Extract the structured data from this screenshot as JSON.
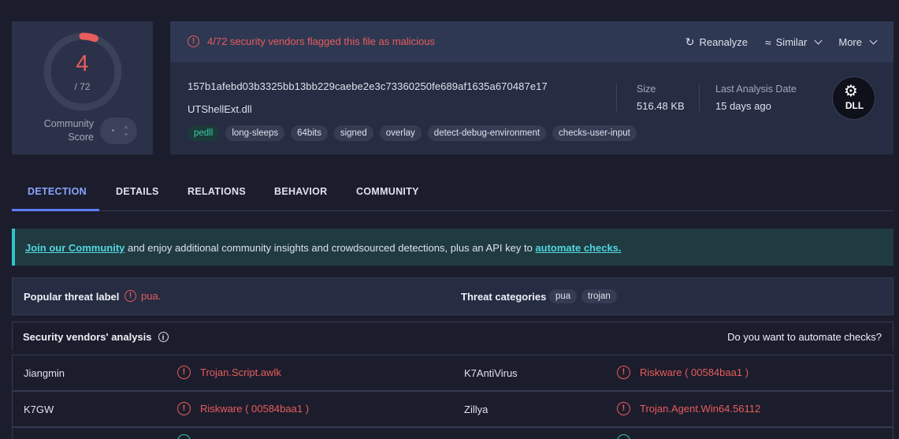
{
  "score": {
    "detections": "4",
    "total": "/ 72",
    "detection_ratio": 0.0556,
    "community_label_line1": "Community",
    "community_label_line2": "Score"
  },
  "header": {
    "flag_text": "4/72 security vendors flagged this file as malicious",
    "actions": {
      "reanalyze": "Reanalyze",
      "similar": "Similar",
      "more": "More"
    }
  },
  "file": {
    "hash": "157b1afebd03b3325bb13bb229caebe2e3c73360250fe689af1635a670487e17",
    "name": "UTShellExt.dll",
    "tags": [
      "pedll",
      "long-sleeps",
      "64bits",
      "signed",
      "overlay",
      "detect-debug-environment",
      "checks-user-input"
    ],
    "size_label": "Size",
    "size_value": "516.48 KB",
    "last_analysis_label": "Last Analysis Date",
    "last_analysis_value": "15 days ago",
    "type_badge": "DLL"
  },
  "tabs": [
    "DETECTION",
    "DETAILS",
    "RELATIONS",
    "BEHAVIOR",
    "COMMUNITY"
  ],
  "banner": {
    "link1": "Join our Community",
    "middle": " and enjoy additional community insights and crowdsourced detections, plus an API key to ",
    "link2": "automate checks."
  },
  "threat": {
    "popular_label": "Popular threat label",
    "popular_value": "pua.",
    "categories_label": "Threat categories",
    "categories": [
      "pua",
      "trojan"
    ]
  },
  "vendors": {
    "title": "Security vendors' analysis",
    "automate": "Do you want to automate checks?",
    "rows": [
      {
        "v1": "Jiangmin",
        "r1": "Trojan.Script.awlk",
        "v2": "K7AntiVirus",
        "r2": "Riskware ( 00584baa1 )"
      },
      {
        "v1": "K7GW",
        "r1": "Riskware ( 00584baa1 )",
        "v2": "Zillya",
        "r2": "Trojan.Agent.Win64.56112"
      }
    ]
  },
  "colors": {
    "malicious": "#e85c5c",
    "accent": "#5f7cff",
    "clean": "#3cc9a2"
  }
}
